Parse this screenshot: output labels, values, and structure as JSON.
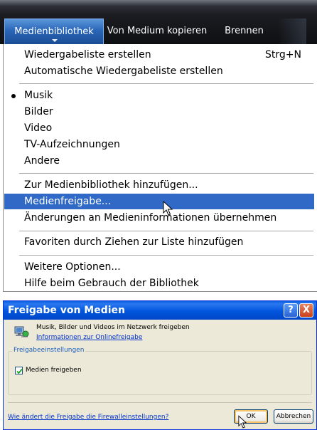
{
  "tabs": [
    {
      "label": "Medienbibliothek",
      "active": true
    },
    {
      "label": "Von Medium kopieren",
      "active": false
    },
    {
      "label": "Brennen",
      "active": false
    }
  ],
  "menu": {
    "items": {
      "create_playlist": {
        "label": "Wiedergabeliste erstellen",
        "shortcut": "Strg+N"
      },
      "auto_playlist": {
        "label": "Automatische Wiedergabeliste erstellen"
      },
      "music": {
        "label": "Musik",
        "checked": true
      },
      "pictures": {
        "label": "Bilder"
      },
      "video": {
        "label": "Video"
      },
      "tv": {
        "label": "TV-Aufzeichnungen"
      },
      "other": {
        "label": "Andere"
      },
      "add_to_library": {
        "label": "Zur Medienbibliothek hinzufügen..."
      },
      "media_sharing": {
        "label": "Medienfreigabe...",
        "highlighted": true
      },
      "apply_media_info": {
        "label": "Änderungen an Medieninformationen übernehmen"
      },
      "add_favorites": {
        "label": "Favoriten durch Ziehen zur Liste hinzufügen"
      },
      "more_options": {
        "label": "Weitere Optionen..."
      },
      "help": {
        "label": "Hilfe beim Gebrauch der Bibliothek"
      }
    }
  },
  "dialog": {
    "title": "Freigabe von Medien",
    "help_button": "?",
    "close_button": "X",
    "description": "Musik, Bilder und Videos im Netzwerk freigeben",
    "info_link": "Informationen zur Onlinefreigabe",
    "group_label": "Freigabeeinstellungen",
    "share_checkbox": {
      "label": "Medien freigeben",
      "checked": true
    },
    "firewall_link": "Wie ändert die Freigabe die Firewalleinstellungen?",
    "ok_label": "OK",
    "cancel_label": "Abbrechen"
  },
  "colors": {
    "menu_highlight": "#3169c6",
    "title_bar": "#0055dd",
    "dialog_bg": "#ece9d8",
    "link": "#0033cc"
  }
}
